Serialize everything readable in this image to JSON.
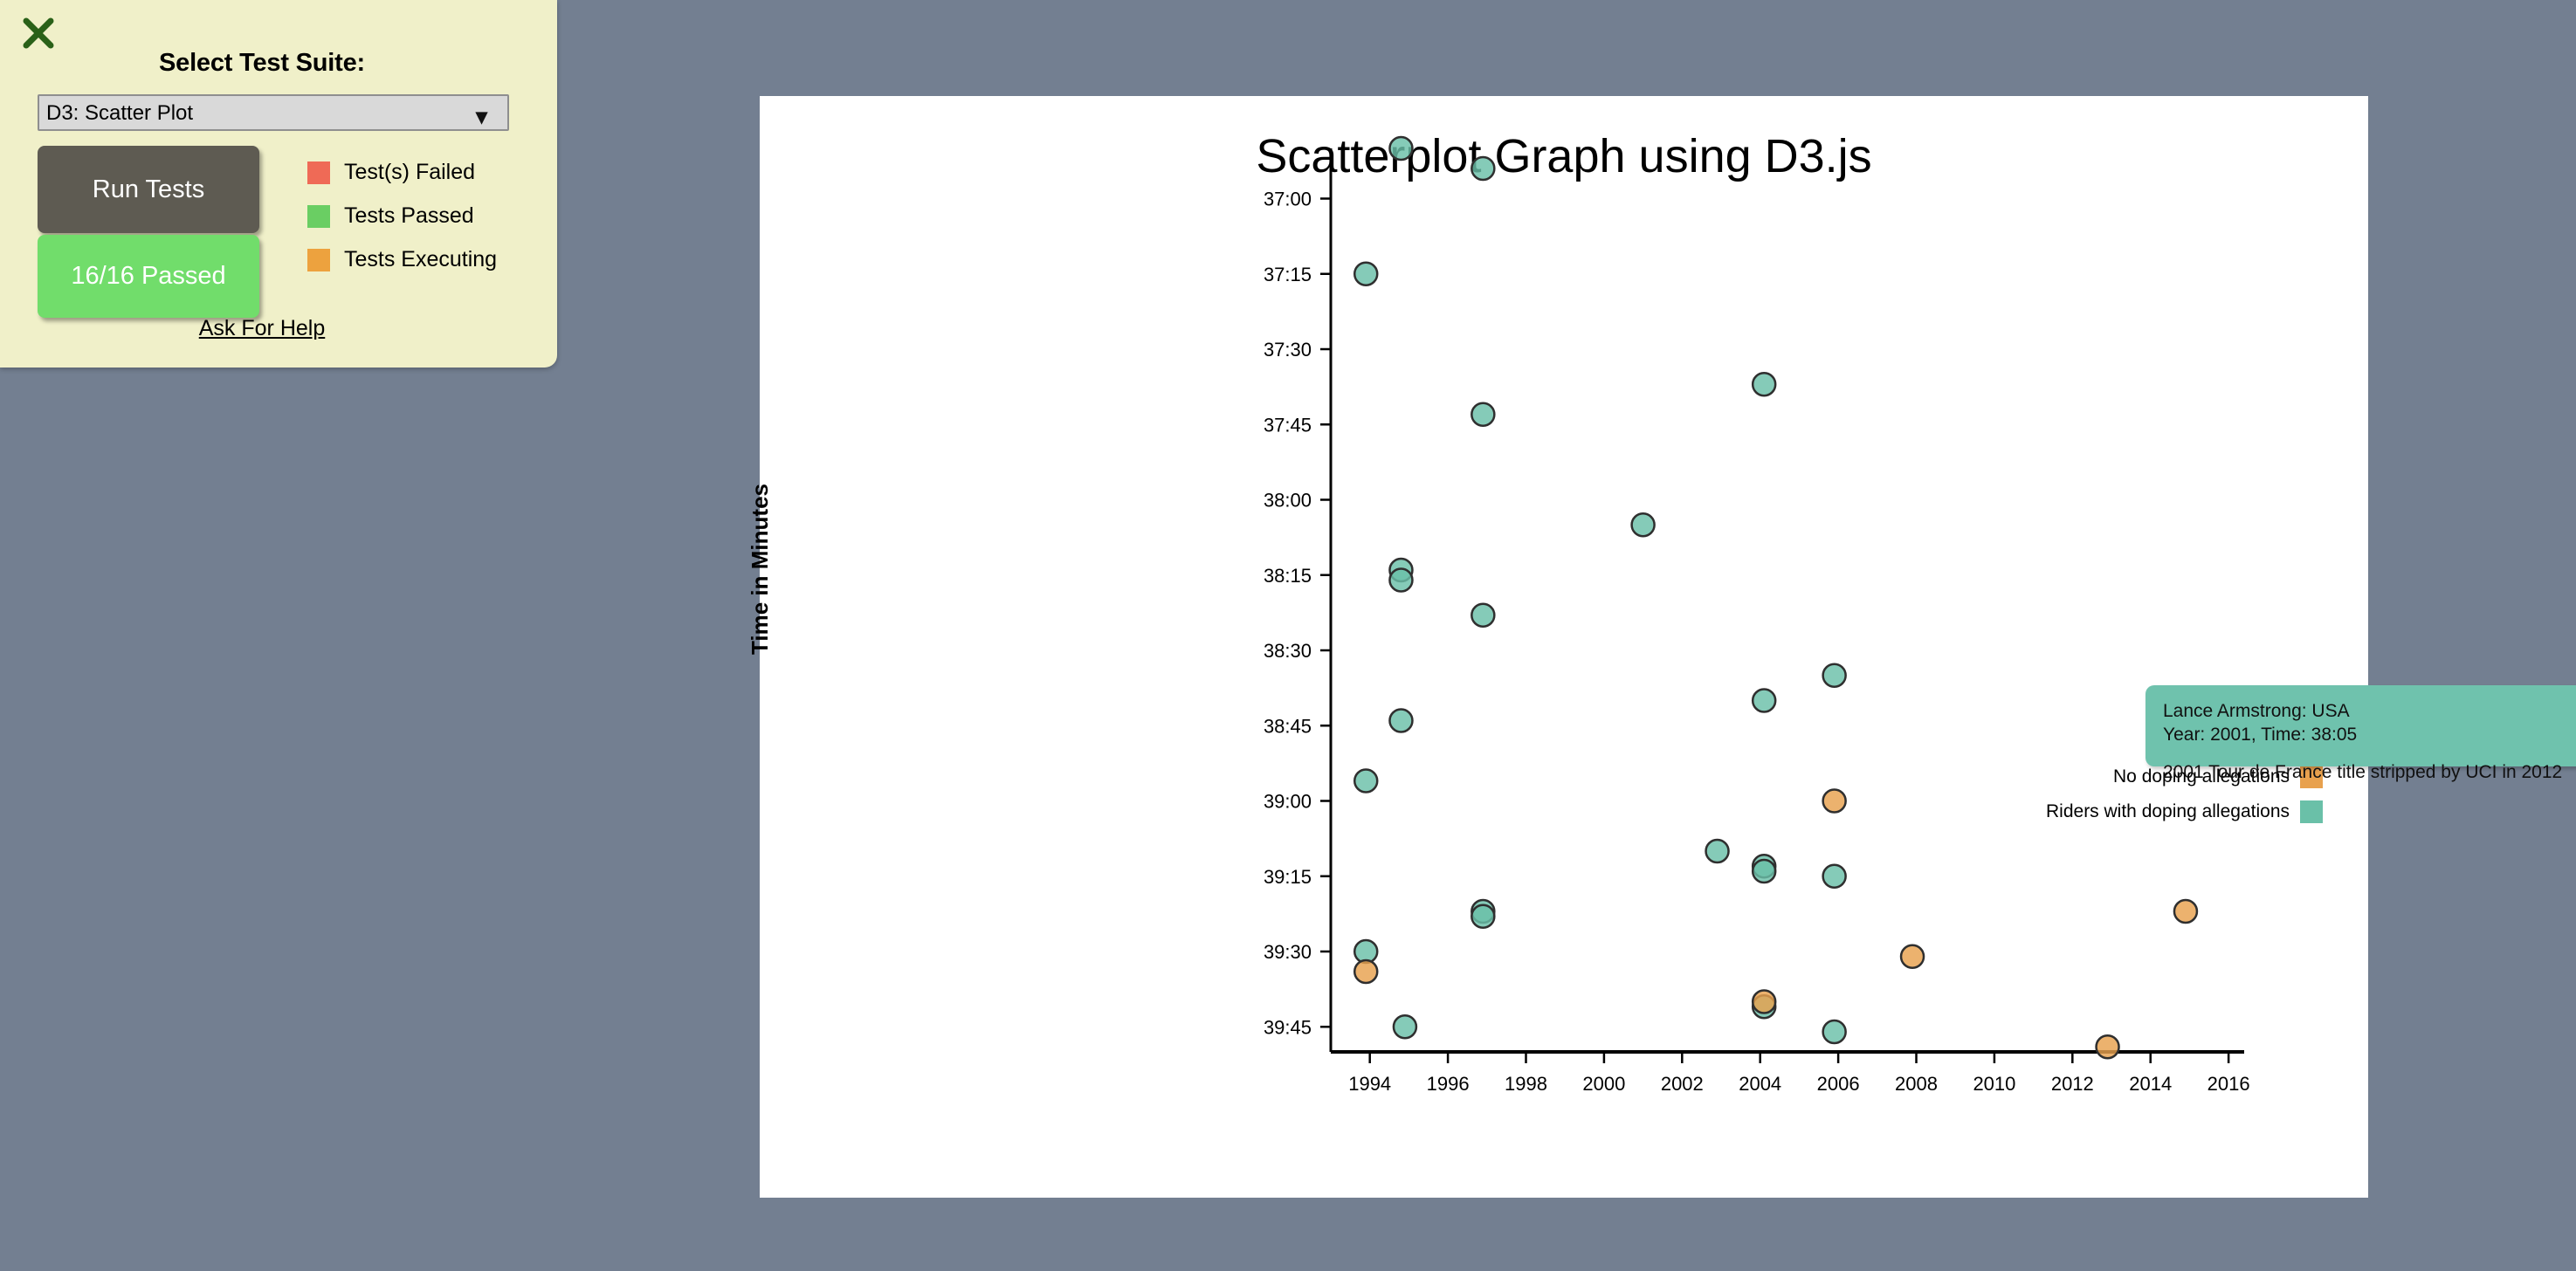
{
  "page": {
    "background_color": "#737f91"
  },
  "test_panel": {
    "background_color": "#f0f0c9",
    "close_icon": "close-x-icon",
    "close_icon_color": "#2a6118",
    "title": "Select Test Suite:",
    "select": {
      "value": "D3: Scatter Plot",
      "options": [
        "D3: Scatter Plot"
      ],
      "chevron": "chevron-down-icon"
    },
    "run_button": {
      "label": "Run Tests",
      "color": "#5e5b52"
    },
    "status_button": {
      "label": "16/16 Passed",
      "color": "#71dd6b"
    },
    "legend": [
      {
        "label": "Test(s) Failed",
        "color": "#ef6a56"
      },
      {
        "label": "Tests Passed",
        "color": "#6ace63"
      },
      {
        "label": "Tests Executing",
        "color": "#eda23e"
      }
    ],
    "help_link": "Ask For Help"
  },
  "chart_card": {
    "background_color": "#ffffff"
  },
  "chart_data": {
    "type": "scatter",
    "title": "Scatterplot Graph using D3.js",
    "xlabel": "",
    "ylabel": "Time in Minutes",
    "xlim": [
      1993,
      2016.4
    ],
    "ylim": [
      "39:50",
      "36:50"
    ],
    "grid": false,
    "legend_position": "right",
    "x_ticks": [
      1994,
      1996,
      1998,
      2000,
      2002,
      2004,
      2006,
      2008,
      2010,
      2012,
      2014,
      2016
    ],
    "y_ticks": [
      "37:00",
      "37:15",
      "37:30",
      "37:45",
      "38:00",
      "38:15",
      "38:30",
      "38:45",
      "39:00",
      "39:15",
      "39:30",
      "39:45"
    ],
    "legend": [
      {
        "name": "No doping allegations",
        "color": "#e8a14e"
      },
      {
        "name": "Riders with doping allegations",
        "color": "#6ac0a8"
      }
    ],
    "series": [
      {
        "name": "Riders with doping allegations",
        "color": "#6ac0a8",
        "points": [
          {
            "year": 1994.8,
            "time": "36:50",
            "doping": true
          },
          {
            "year": 1996.9,
            "time": "36:54",
            "doping": true
          },
          {
            "year": 1993.9,
            "time": "37:15",
            "doping": true
          },
          {
            "year": 2004.1,
            "time": "37:37",
            "doping": true
          },
          {
            "year": 1996.9,
            "time": "37:43",
            "doping": true
          },
          {
            "year": 2001.0,
            "time": "38:05",
            "doping": true
          },
          {
            "year": 1994.8,
            "time": "38:14",
            "doping": true
          },
          {
            "year": 1994.8,
            "time": "38:16",
            "doping": true
          },
          {
            "year": 1996.9,
            "time": "38:23",
            "doping": true
          },
          {
            "year": 2005.9,
            "time": "38:35",
            "doping": true
          },
          {
            "year": 2004.1,
            "time": "38:40",
            "doping": true
          },
          {
            "year": 1994.8,
            "time": "38:44",
            "doping": true
          },
          {
            "year": 1993.9,
            "time": "38:56",
            "doping": true
          },
          {
            "year": 2002.9,
            "time": "39:10",
            "doping": true
          },
          {
            "year": 2004.1,
            "time": "39:13",
            "doping": true
          },
          {
            "year": 2004.1,
            "time": "39:14",
            "doping": true
          },
          {
            "year": 2005.9,
            "time": "39:15",
            "doping": true
          },
          {
            "year": 1996.9,
            "time": "39:22",
            "doping": true
          },
          {
            "year": 1996.9,
            "time": "39:23",
            "doping": true
          },
          {
            "year": 1993.9,
            "time": "39:30",
            "doping": true
          },
          {
            "year": 2004.1,
            "time": "39:41",
            "doping": true
          },
          {
            "year": 1994.9,
            "time": "39:45",
            "doping": true
          },
          {
            "year": 2005.9,
            "time": "39:46",
            "doping": true
          }
        ]
      },
      {
        "name": "No doping allegations",
        "color": "#e8a14e",
        "points": [
          {
            "year": 2005.9,
            "time": "39:00",
            "doping": false
          },
          {
            "year": 2007.9,
            "time": "39:31",
            "doping": false
          },
          {
            "year": 2014.9,
            "time": "39:22",
            "doping": false
          },
          {
            "year": 2012.9,
            "time": "39:49",
            "doping": false
          },
          {
            "year": 1993.9,
            "time": "39:34",
            "doping": false
          },
          {
            "year": 2004.1,
            "time": "39:40",
            "doping": false
          }
        ]
      }
    ],
    "tooltip": {
      "visible": true,
      "line1": "Lance Armstrong: USA",
      "line2": "Year: 2001, Time: 38:05",
      "line3": "2001 Tour de France title stripped by UCI in 2012",
      "background_color": "#6fc2ad"
    }
  }
}
